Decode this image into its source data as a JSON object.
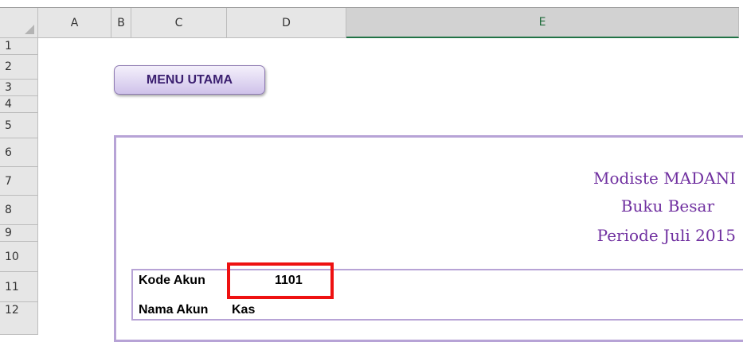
{
  "sheet": {
    "columns": [
      "A",
      "B",
      "C",
      "D",
      "E"
    ],
    "selected_column": "E",
    "rows": [
      "1",
      "2",
      "3",
      "4",
      "5",
      "6",
      "7",
      "8",
      "9",
      "10",
      "11",
      "12"
    ]
  },
  "menu_button": {
    "label": "MENU UTAMA"
  },
  "report": {
    "company": "Modiste MADANI",
    "title": "Buku Besar",
    "period": "Periode Juli 2015"
  },
  "account": {
    "code_label": "Kode Akun",
    "code_value": "1101",
    "name_label": "Nama Akun",
    "name_value": "Kas"
  },
  "colors": {
    "accent_purple": "#7030a0",
    "border_purple": "#b7a3d6",
    "highlight_red": "#ee1111",
    "excel_green": "#217346"
  }
}
